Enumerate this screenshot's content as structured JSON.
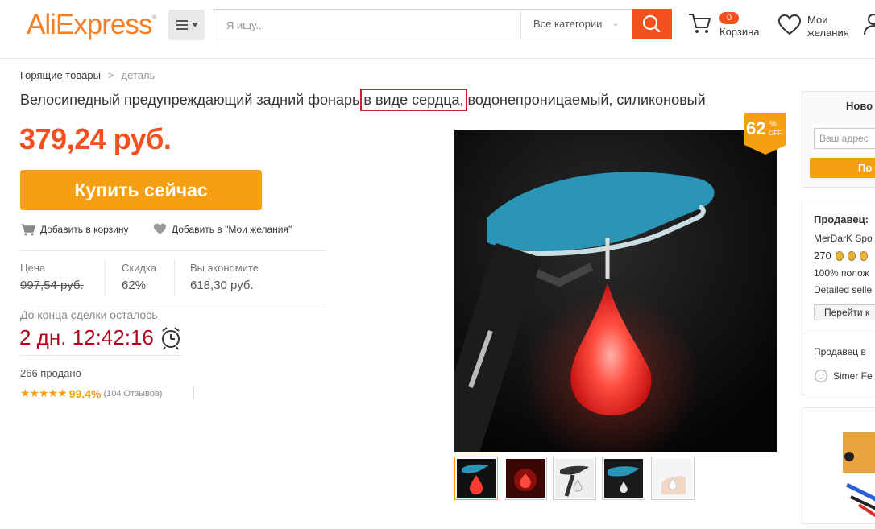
{
  "header": {
    "logo_text": "AliExpress",
    "logo_mark": "®",
    "search_placeholder": "Я ищу...",
    "category_label": "Все категории",
    "cart_count": "0",
    "cart_label": "Корзина",
    "wishlist_label_line1": "Мои",
    "wishlist_label_line2": "желания"
  },
  "breadcrumb": {
    "items": [
      "Горящие товары",
      "деталь"
    ],
    "separator": ">"
  },
  "product": {
    "title_before": "Велосипедный предупреждающий задний фонарь ",
    "title_highlight": "в виде сердца,",
    "title_after": " водонепроницаемый, силиконовый",
    "price": "379,24 руб.",
    "buy_label": "Купить сейчас",
    "add_cart_label": "Добавить в корзину",
    "add_wish_label": "Добавить в \"Мои желания\"",
    "price_label": "Цена",
    "old_price": "997,54 руб.",
    "discount_label": "Скидка",
    "discount_value": "62%",
    "save_label": "Вы экономите",
    "save_value": "618,30 руб.",
    "deal_label": "До конца сделки осталось",
    "timer": "2 дн. 12:42:16",
    "sold": "266 продано",
    "stars": "★★★★★",
    "rating": "99.4%",
    "reviews": "(104 Отзывов)",
    "badge_number": "62",
    "badge_percent": "%",
    "badge_off": "OFF"
  },
  "sidebar": {
    "box_title": "Ново",
    "address_placeholder": "Ваш адрес",
    "box_button": "По",
    "seller_title": "Продавец:",
    "seller_name": "MerDarK Spo",
    "seller_score": "270",
    "seller_positive": "100% полож",
    "seller_detailed": "Detailed selle",
    "seller_go": "Перейти к",
    "seller_in": "Продавец в",
    "seller_other": "Simer Fe"
  },
  "colors": {
    "brand_orange": "#f69f13",
    "price_red": "#f2501d",
    "timer_red": "#b3001b",
    "highlight_box": "#c0272d"
  }
}
